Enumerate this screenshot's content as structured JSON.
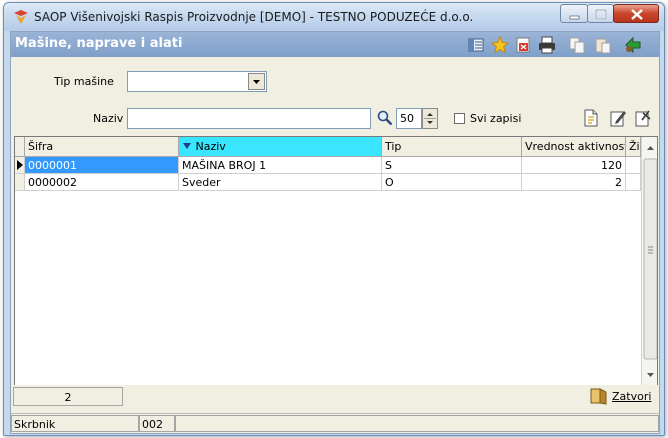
{
  "window": {
    "title": "SAOP  Višenivojski Raspis Proizvodnje [DEMO] - TESTNO PODUZEĆE d.o.o."
  },
  "panel": {
    "title": "Mašine, naprave i alati",
    "toolbar_icons": [
      "list-view-icon",
      "favorite-star-icon",
      "close-document-icon",
      "print-icon",
      "copy-icon",
      "paste-icon",
      "exit-icon"
    ]
  },
  "filters": {
    "type_label": "Tip mašine",
    "type_value": "",
    "name_label": "Naziv",
    "name_value": "",
    "page_size": "50",
    "all_records_label": "Svi zapisi",
    "all_records_checked": false,
    "action_icons": [
      "new-record-icon",
      "edit-record-icon",
      "delete-record-icon"
    ]
  },
  "grid": {
    "columns": [
      "Šifra",
      "Naziv",
      "Tip",
      "Vrednost aktivnosti",
      "Životni"
    ],
    "sorted_column": "Naziv",
    "rows": [
      {
        "sifra": "0000001",
        "naziv": "MAŠINA BROJ 1",
        "tip": "S",
        "vrednost": "120",
        "zivot": ""
      },
      {
        "sifra": "0000002",
        "naziv": "Sveder",
        "tip": "O",
        "vrednost": "2",
        "zivot": ""
      }
    ]
  },
  "footer": {
    "record_count": "2",
    "close_label": "Zatvori"
  },
  "statusbar": {
    "owner_label": "Skrbnik",
    "owner_value": "002"
  },
  "colors": {
    "header_blue": "#7f9fc9",
    "sorted_header": "#39e5ff",
    "selected_cell": "#3399ff"
  }
}
